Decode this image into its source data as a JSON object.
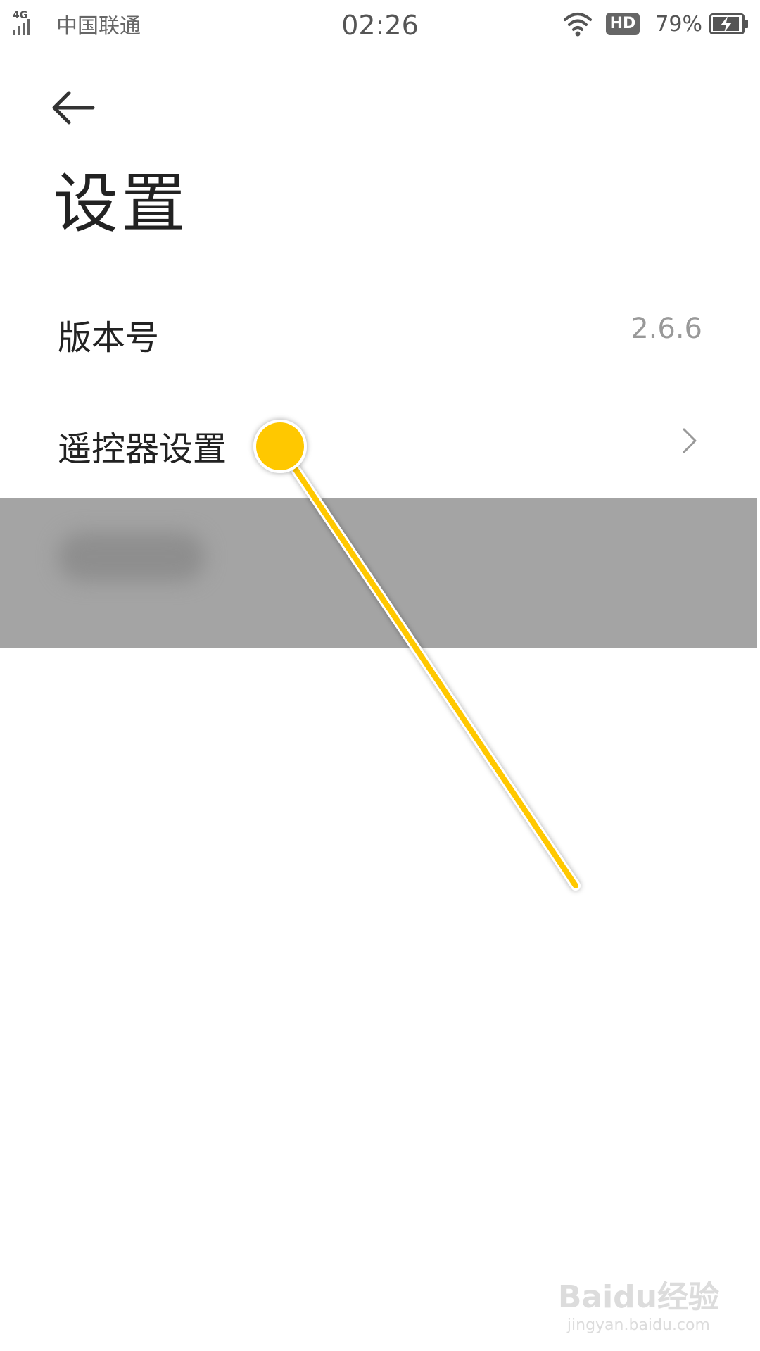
{
  "status_bar": {
    "network_type": "4G",
    "carrier": "中国联通",
    "time": "02:26",
    "hd_label": "HD",
    "battery_percent": "79%",
    "icons": [
      "signal-icon",
      "wifi-icon",
      "battery-charging-icon"
    ]
  },
  "header": {
    "back_icon": "arrow-left-icon",
    "title": "设置"
  },
  "settings": {
    "items": [
      {
        "label": "版本号",
        "value": "2.6.6"
      },
      {
        "label": "遥控器设置",
        "icon": "chevron-right-icon"
      }
    ]
  },
  "watermark": {
    "logo": "Baidu经验",
    "url": "jingyan.baidu.com"
  },
  "colors": {
    "background": "#ffffff",
    "title_text": "#222222",
    "secondary_text": "#999999",
    "blurred_band": "#a4a4a4",
    "annotation": "#ffc800"
  }
}
